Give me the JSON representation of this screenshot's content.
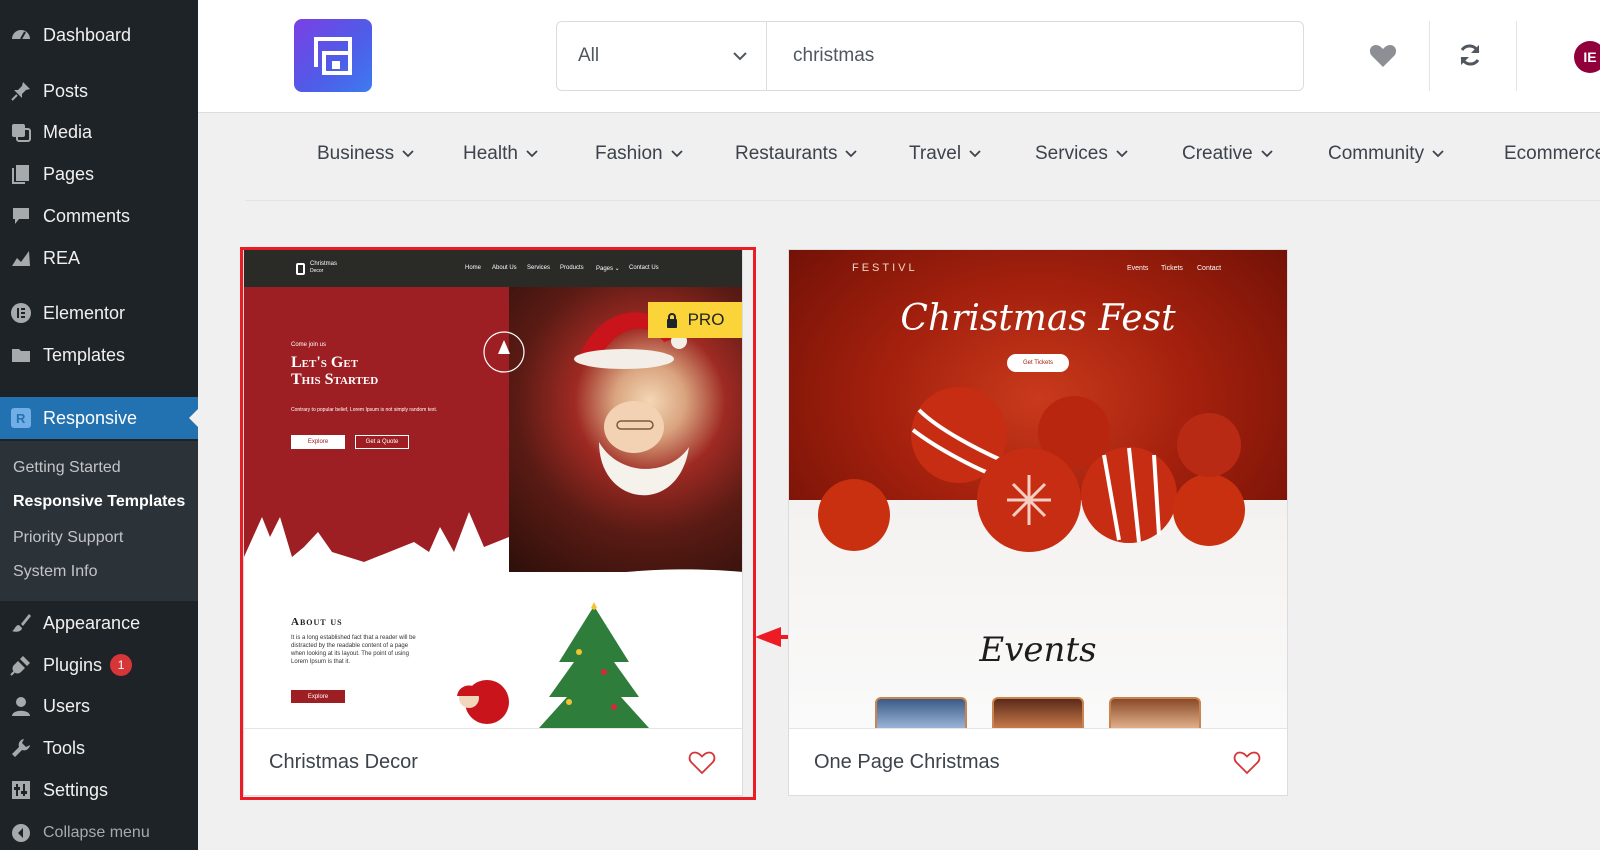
{
  "sidebar": {
    "menu": [
      {
        "label": "Dashboard",
        "icon": "dashboard-icon"
      },
      {
        "label": "Posts",
        "icon": "pin-icon"
      },
      {
        "label": "Media",
        "icon": "media-icon"
      },
      {
        "label": "Pages",
        "icon": "pages-icon"
      },
      {
        "label": "Comments",
        "icon": "comments-icon"
      },
      {
        "label": "REA",
        "icon": "chart-icon"
      },
      {
        "label": "Elementor",
        "icon": "elementor-icon"
      },
      {
        "label": "Templates",
        "icon": "folder-icon"
      },
      {
        "label": "Responsive",
        "icon": "responsive-icon"
      },
      {
        "label": "Appearance",
        "icon": "brush-icon"
      },
      {
        "label": "Plugins",
        "icon": "plugin-icon",
        "badge": "1"
      },
      {
        "label": "Users",
        "icon": "user-icon"
      },
      {
        "label": "Tools",
        "icon": "wrench-icon"
      },
      {
        "label": "Settings",
        "icon": "settings-icon"
      }
    ],
    "submenu": [
      "Getting Started",
      "Responsive Templates",
      "Priority Support",
      "System Info"
    ],
    "collapse_label": "Collapse menu"
  },
  "header": {
    "category_select": "All",
    "search_value": "christmas",
    "elementor_glyph": "IE"
  },
  "categories": [
    "Business",
    "Health",
    "Fashion",
    "Restaurants",
    "Travel",
    "Services",
    "Creative",
    "Community",
    "Ecommerce"
  ],
  "cards": [
    {
      "title": "Christmas Decor",
      "pro_label": "PRO",
      "preview": {
        "brand": "Christmas",
        "brand_sub": "Decor",
        "nav": [
          "Home",
          "About Us",
          "Services",
          "Products",
          "Pages ⌄",
          "Contact Us"
        ],
        "eyebrow": "Come join us",
        "headline_1": "Let's Get",
        "headline_2": "This Started",
        "body": "Contrary to popular belief, Lorem Ipsum is not simply random text.",
        "btn_1": "Explore",
        "btn_2": "Get a Quote",
        "about_title": "About us",
        "about_body": "It is a long established fact that a reader will be distracted by the readable content of a page when looking at its layout. The point of using Lorem Ipsum is that it.",
        "about_btn": "Explore"
      }
    },
    {
      "title": "One Page Christmas",
      "preview": {
        "brand": "FESTIVL",
        "nav": [
          "Events",
          "Tickets",
          "Contact"
        ],
        "headline": "Christmas Fest",
        "btn": "Get Tickets",
        "section": "Events"
      }
    }
  ],
  "colors": {
    "sidebar_bg": "#1d2327",
    "active": "#2271b1",
    "highlight": "#ec1c24",
    "pro": "#fbd439"
  }
}
